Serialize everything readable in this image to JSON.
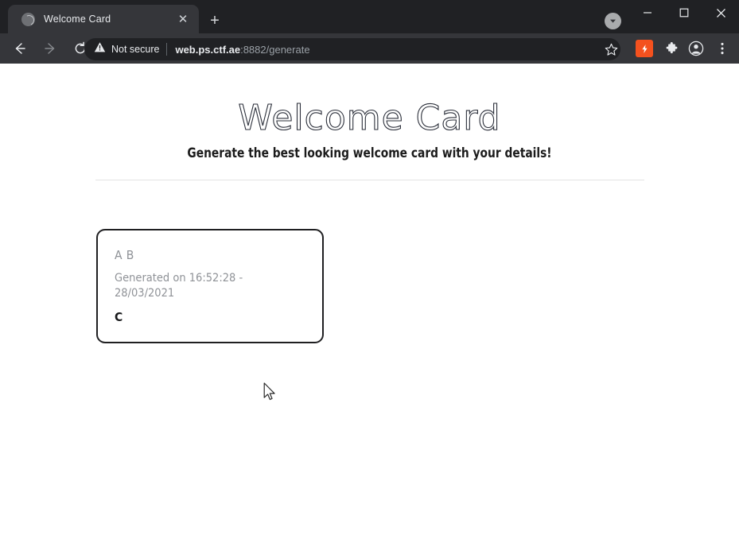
{
  "browser": {
    "tab": {
      "title": "Welcome Card",
      "favicon_icon": "globe-icon",
      "close_icon": "✕"
    },
    "new_tab_icon": "+",
    "window_controls": {
      "download_icon": "download-chevron-icon",
      "minimize": "–",
      "maximize": "□",
      "close": "✕"
    },
    "toolbar": {
      "back_icon": "arrow-left-icon",
      "forward_icon": "arrow-right-icon",
      "reload_icon": "reload-icon",
      "security_icon": "warning-triangle-icon",
      "security_label": "Not secure",
      "url_host": "web.ps.ctf.ae",
      "url_rest": ":8882/generate",
      "bookmark_icon": "star-icon",
      "extension_orange_icon": "lightning-bolt-icon",
      "extensions_icon": "puzzle-piece-icon",
      "profile_icon": "account-avatar-icon",
      "menu_icon": "three-dot-menu-icon"
    },
    "colors": {
      "tabstrip_bg": "#202124",
      "toolbar_bg": "#35363a",
      "active_tab_bg": "#35363a",
      "omnibox_bg": "#202124",
      "extension_accent": "#f4511e",
      "text_primary": "#e8eaed",
      "text_muted": "#9aa0a6"
    }
  },
  "page": {
    "title": "Welcome Card",
    "subtitle": "Generate the best looking welcome card with your details!",
    "card": {
      "name": "A B",
      "generated": "Generated on 16:52:28 - 28/03/2021",
      "extra": "C"
    },
    "colors": {
      "background": "#ffffff",
      "title_stroke": "#2b2f3a",
      "divider": "#e3e3e3",
      "card_border": "#1f1f21",
      "card_muted_text": "#8f9297",
      "card_dark_text": "#17181a"
    }
  }
}
